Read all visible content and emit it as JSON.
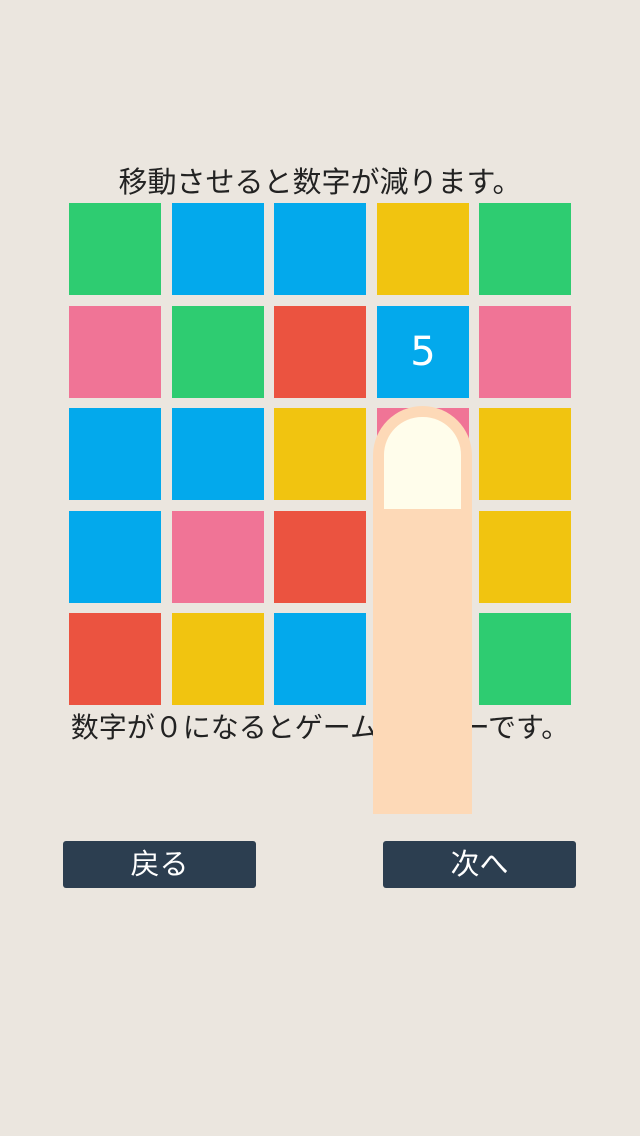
{
  "instructions": {
    "top": "移動させると数字が減ります。",
    "bottom": "数字が０になるとゲームオーバーです。"
  },
  "colors": {
    "background": "#ebe6df",
    "green": "#2ecc71",
    "blue": "#03a9ec",
    "yellow": "#f1c410",
    "pink": "#f07496",
    "red": "#eb5340",
    "button": "#2c3e50",
    "finger": "#fdd9b7",
    "fingernail": "#fffdeb"
  },
  "board": {
    "rows": 5,
    "cols": 5,
    "tiles": [
      [
        "green",
        "blue",
        "blue",
        "yellow",
        "green"
      ],
      [
        "pink",
        "green",
        "red",
        "blue",
        "pink"
      ],
      [
        "blue",
        "blue",
        "yellow",
        "pink",
        "yellow"
      ],
      [
        "blue",
        "pink",
        "red",
        null,
        "yellow"
      ],
      [
        "red",
        "yellow",
        "blue",
        null,
        "green"
      ]
    ],
    "highlighted_tile": {
      "row": 1,
      "col": 3,
      "number": "5"
    }
  },
  "buttons": {
    "back": "戻る",
    "next": "次へ"
  }
}
